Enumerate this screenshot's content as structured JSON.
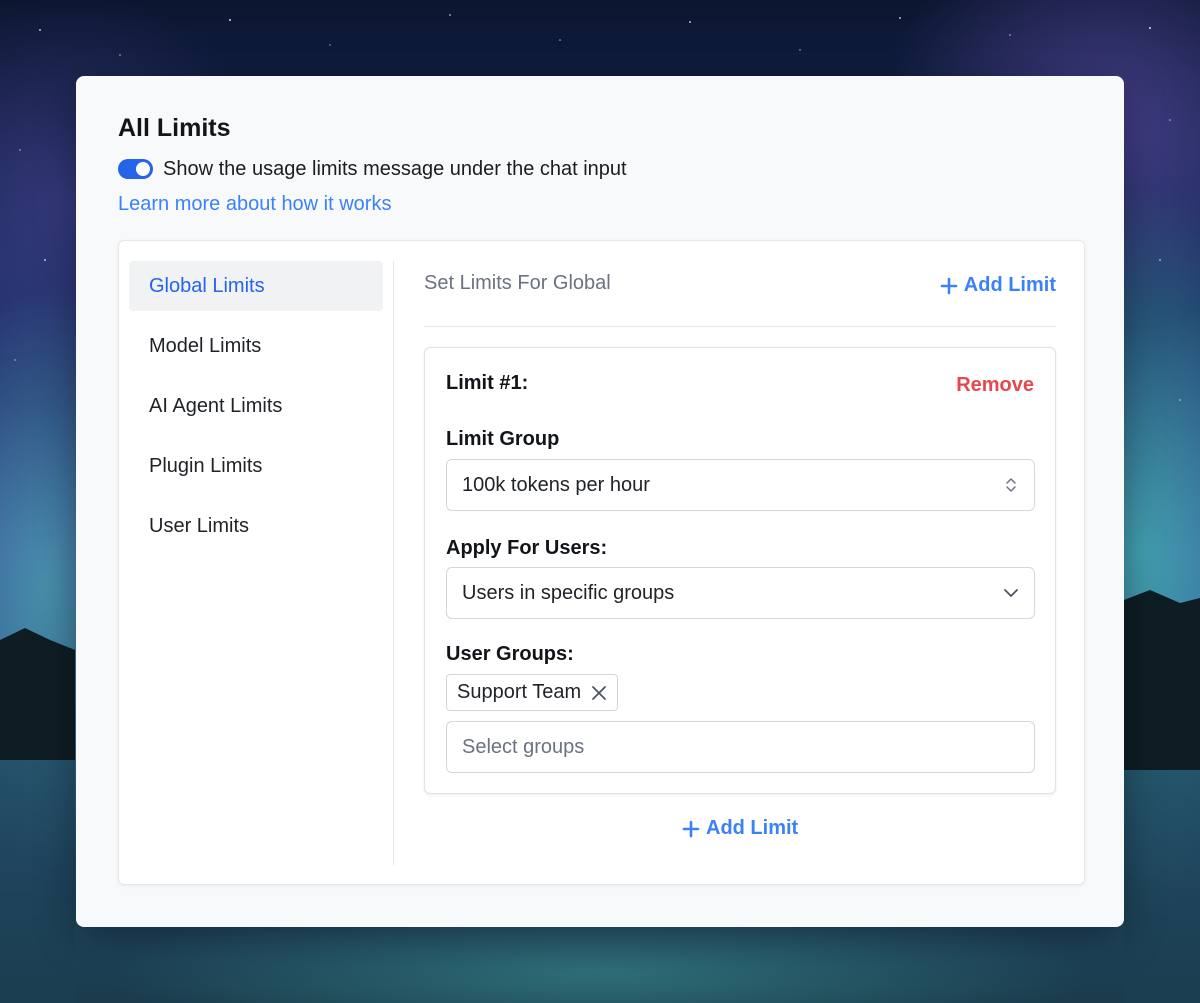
{
  "page": {
    "title": "All Limits",
    "toggle": {
      "on": true,
      "label": "Show the usage limits message under the chat input"
    },
    "learn_more": "Learn more about how it works"
  },
  "sidebar": {
    "items": [
      {
        "label": "Global Limits",
        "active": true
      },
      {
        "label": "Model Limits",
        "active": false
      },
      {
        "label": "AI Agent Limits",
        "active": false
      },
      {
        "label": "Plugin Limits",
        "active": false
      },
      {
        "label": "User Limits",
        "active": false
      }
    ]
  },
  "main": {
    "heading": "Set Limits For Global",
    "add_limit_label": "Add Limit",
    "limit": {
      "title": "Limit #1:",
      "remove_label": "Remove",
      "limit_group": {
        "label": "Limit Group",
        "value": "100k tokens per hour"
      },
      "apply_for_users": {
        "label": "Apply For Users:",
        "value": "Users in specific groups"
      },
      "user_groups": {
        "label": "User Groups:",
        "tags": [
          "Support Team"
        ],
        "placeholder": "Select groups"
      }
    },
    "add_limit_bottom_label": "Add Limit"
  },
  "icons": {
    "plus": "plus-icon",
    "updown": "chevron-updown-icon",
    "down": "chevron-down-icon",
    "close": "close-icon"
  },
  "colors": {
    "accent": "#2563eb",
    "link": "#3b82f6",
    "danger": "#e5484d"
  }
}
